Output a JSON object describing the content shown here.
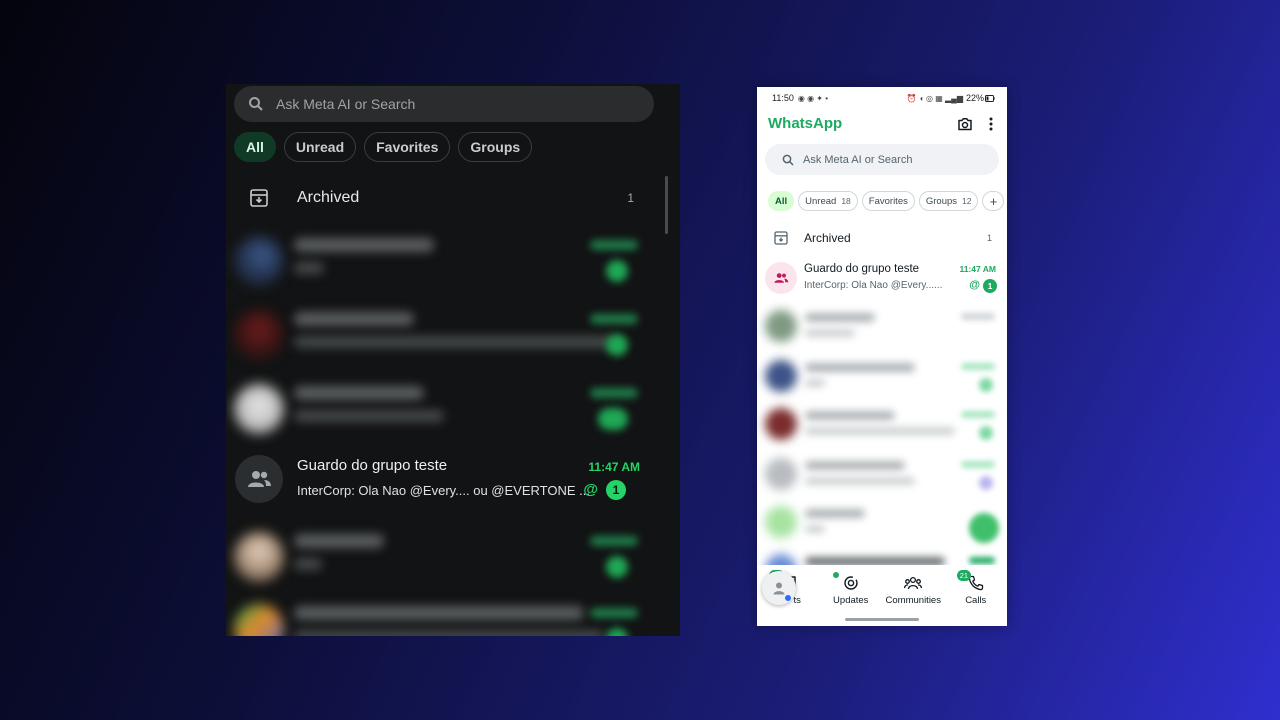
{
  "dark_panel": {
    "search_placeholder": "Ask Meta AI or Search",
    "filters": [
      "All",
      "Unread",
      "Favorites",
      "Groups"
    ],
    "archived": {
      "label": "Archived",
      "count": "1"
    },
    "group_chat": {
      "name": "Guardo do grupo teste",
      "time": "11:47 AM",
      "message": "InterCorp: Ola   Nao @Every.... ou @EVERTONE ...",
      "mention": "@",
      "unread": "1"
    }
  },
  "phone": {
    "status_time": "11:50",
    "status_battery": "22%",
    "title": "WhatsApp",
    "search_placeholder": "Ask Meta AI or Search",
    "filters": {
      "all": "All",
      "unread": "Unread",
      "unread_count": "18",
      "favorites": "Favorites",
      "groups": "Groups",
      "groups_count": "12",
      "add": "+"
    },
    "archived": {
      "label": "Archived",
      "count": "1"
    },
    "group_chat": {
      "name": "Guardo do grupo teste",
      "time": "11:47 AM",
      "message": "InterCorp: Ola   Nao @Every......",
      "mention": "@",
      "unread": "1"
    },
    "bottom_nav": {
      "chats_label": "ts",
      "chats_badge": "18",
      "updates_label": "Updates",
      "communities_label": "Communities",
      "calls_label": "Calls",
      "calls_badge": "21"
    }
  },
  "colors": {
    "accent_green": "#25d366",
    "brand_green": "#1daa61",
    "dark_bg": "#121314"
  }
}
